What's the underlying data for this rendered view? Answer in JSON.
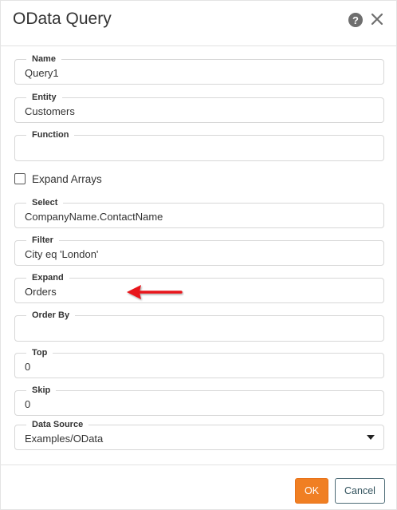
{
  "dialog": {
    "title": "OData Query",
    "help_icon": "question-circle-icon",
    "help_glyph": "?",
    "close_icon": "close-icon"
  },
  "fields": {
    "name": {
      "label": "Name",
      "value": "Query1"
    },
    "entity": {
      "label": "Entity",
      "value": "Customers"
    },
    "function": {
      "label": "Function",
      "value": ""
    },
    "select": {
      "label": "Select",
      "value": "CompanyName.ContactName"
    },
    "filter": {
      "label": "Filter",
      "value": "City eq 'London'"
    },
    "expand": {
      "label": "Expand",
      "value": "Orders"
    },
    "order_by": {
      "label": "Order By",
      "value": ""
    },
    "top": {
      "label": "Top",
      "value": "0"
    },
    "skip": {
      "label": "Skip",
      "value": "0"
    },
    "data_source": {
      "label": "Data Source",
      "value": "Examples/OData"
    }
  },
  "expand_arrays": {
    "label": "Expand Arrays",
    "checked": false
  },
  "annotation": {
    "arrow_color": "#e8191c"
  },
  "footer": {
    "ok_label": "OK",
    "cancel_label": "Cancel"
  },
  "colors": {
    "accent": "#f07f23",
    "cancel_border": "#4d6b76"
  }
}
